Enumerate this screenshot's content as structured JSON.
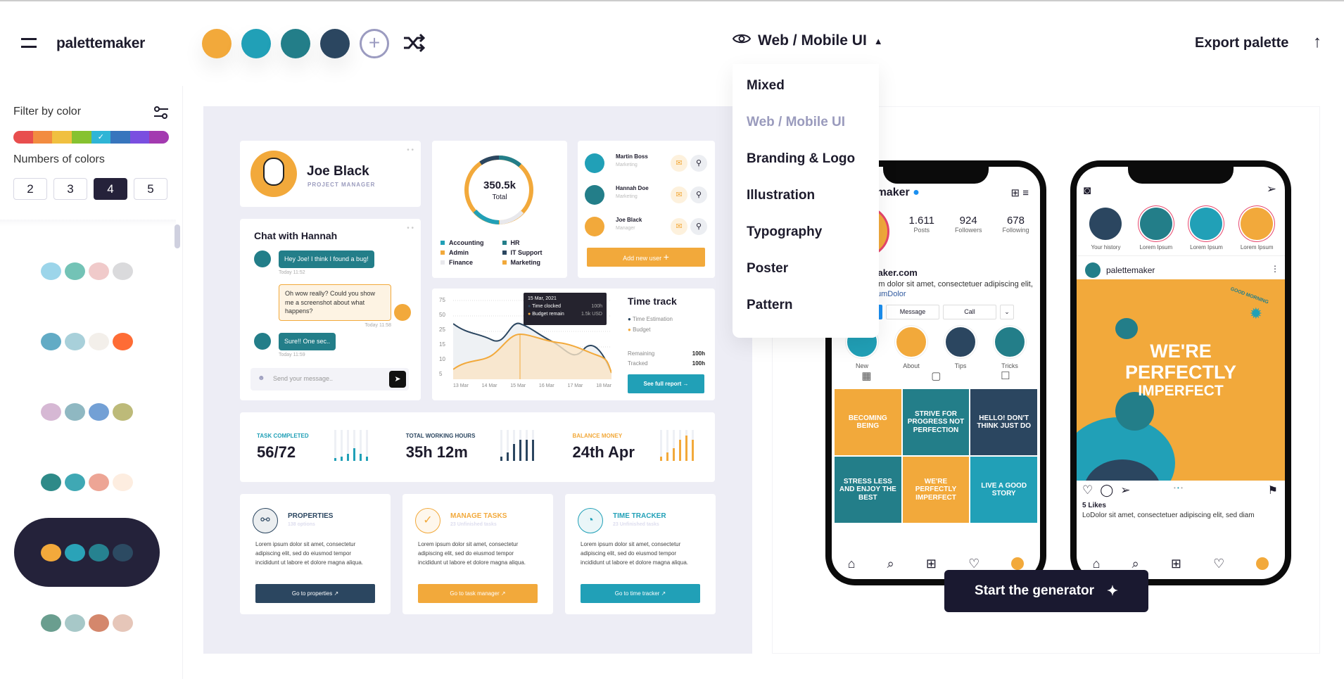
{
  "header": {
    "logo": "palettemaker",
    "palette": [
      "#F2A93B",
      "#21A0B7",
      "#237E89",
      "#2B4660"
    ],
    "add_label": "+",
    "view_label": "Web / Mobile UI",
    "export_label": "Export palette"
  },
  "dropdown": {
    "items": [
      "Mixed",
      "Web / Mobile UI",
      "Branding & Logo",
      "Illustration",
      "Typography",
      "Poster",
      "Pattern"
    ],
    "active": "Web / Mobile UI"
  },
  "sidebar": {
    "filter_label": "Filter by color",
    "color_strip": [
      "#E84E4E",
      "#F28C40",
      "#F0C040",
      "#86C230",
      "#2FB5D6",
      "#3775BD",
      "#7A4FE0",
      "#A33AB0"
    ],
    "selected_color": "#2FB5D6",
    "check": "✓",
    "numbers_label": "Numbers of colors",
    "numbers": [
      "2",
      "3",
      "4",
      "5"
    ],
    "selected_number": "4",
    "palettes": [
      [
        "#9CD5EA",
        "#73C3B6",
        "#F0CACA",
        "#DADADC"
      ],
      [
        "#62ABC5",
        "#A8D0DA",
        "#F3EFEA",
        "#FE6C35"
      ],
      [
        "#D6B8D4",
        "#8FB8C2",
        "#73A0D5",
        "#BDBA79"
      ],
      [
        "#2E8A88",
        "#3FA8B4",
        "#EDA595",
        "#FDEDE0"
      ],
      [
        "#F2A93B",
        "#2AA3B8",
        "#268290",
        "#2C4A62"
      ],
      [
        "#6A9E8F",
        "#A7C8C8",
        "#D4876C",
        "#E6C6B9"
      ]
    ],
    "selected_palette": 4
  },
  "dashboard": {
    "profile": {
      "name": "Joe Black",
      "role": "PROJECT MANAGER"
    },
    "donut": {
      "total": "350.5k",
      "label": "Total",
      "legend": [
        {
          "label": "Accounting",
          "color": "#21A0B7"
        },
        {
          "label": "HR",
          "color": "#237E89"
        },
        {
          "label": "Admin",
          "color": "#F2A93B"
        },
        {
          "label": "IT Support",
          "color": "#2B4660"
        },
        {
          "label": "Finance",
          "color": "#E8E8EC"
        },
        {
          "label": "Marketing",
          "color": "#F2A93B"
        }
      ]
    },
    "users": [
      {
        "name": "Martin Boss",
        "role": "Marketing",
        "color": "#21A0B7"
      },
      {
        "name": "Hannah Doe",
        "role": "Marketing",
        "color": "#237E89"
      },
      {
        "name": "Joe Black",
        "role": "Manager",
        "color": "#F2A93B"
      }
    ],
    "add_user": "Add new user",
    "chat": {
      "title": "Chat with Hannah",
      "messages": [
        {
          "text": "Hey Joe! I think I found a bug!",
          "time": "Today 11:52",
          "mine": false
        },
        {
          "text": "Oh wow really? Could you show me a screenshot about what happens?",
          "time": "Today 11:58",
          "mine": true
        },
        {
          "text": "Sure!! One sec..",
          "time": "Today 11:59",
          "mine": false
        }
      ],
      "placeholder": "Send your message.."
    },
    "timetrack": {
      "title": "Time track",
      "y_ticks": [
        "75",
        "50",
        "25",
        "15",
        "10",
        "5"
      ],
      "x_ticks": [
        "13 Mar",
        "14 Mar",
        "15 Mar",
        "16 Mar",
        "17 Mar",
        "18 Mar"
      ],
      "tooltip": {
        "date": "15 Mar, 2021",
        "rows": [
          {
            "label": "Time clocked",
            "value": "100h"
          },
          {
            "label": "Budget remain",
            "value": "1.5k USD"
          }
        ]
      },
      "legend": [
        "Time Estimation",
        "Budget"
      ],
      "remaining_label": "Remaining",
      "remaining": "100h",
      "tracked_label": "Tracked",
      "tracked": "100h",
      "report_btn": "See full report"
    },
    "stats": [
      {
        "label": "TASK COMPLETED",
        "value": "56/72",
        "color": "#21A0B7"
      },
      {
        "label": "TOTAL WORKING HOURS",
        "value": "35h 12m",
        "color": "#2B4660"
      },
      {
        "label": "BALANCE MONEY",
        "value": "24th Apr",
        "color": "#F2A93B"
      }
    ],
    "cards": [
      {
        "title": "PROPERTIES",
        "sub": "138 options",
        "text": "Lorem ipsum dolor sit amet, consectetur adipiscing elit, sed do eiusmod tempor incididunt ut labore et dolore magna aliqua.",
        "btn": "Go to properties",
        "color": "#2B4660"
      },
      {
        "title": "MANAGE TASKS",
        "sub": "23 Unfinished tasks",
        "text": "Lorem ipsum dolor sit amet, consectetur adipiscing elit, sed do eiusmod tempor incididunt ut labore et dolore magna aliqua.",
        "btn": "Go to task manager",
        "color": "#F2A93B"
      },
      {
        "title": "TIME TRACKER",
        "sub": "23 Unfinished tasks",
        "text": "Lorem ipsum dolor sit amet, consectetur adipiscing elit, sed do eiusmod tempor incididunt ut labore et dolore magna aliqua.",
        "btn": "Go to time tracker",
        "color": "#21A0B7"
      }
    ]
  },
  "phone1": {
    "username": "palettemaker",
    "stats": [
      {
        "n": "1.611",
        "l": "Posts"
      },
      {
        "n": "924",
        "l": "Followers"
      },
      {
        "n": "678",
        "l": "Following"
      }
    ],
    "site": "palettemaker.com",
    "bio": "Lorem ipsum dolor sit amet, consectetuer adipiscing elit,",
    "hashtag": "#LoremIpsumDolor",
    "btn_message": "Message",
    "btn_call": "Call",
    "highlights": [
      {
        "l": "New",
        "c": "#21A0B7"
      },
      {
        "l": "About",
        "c": "#F2A93B"
      },
      {
        "l": "Tips",
        "c": "#2B4660"
      },
      {
        "l": "Tricks",
        "c": "#237E89"
      }
    ],
    "tiles": [
      {
        "t": "BECOMING BEING",
        "bg": "#F2A93B"
      },
      {
        "t": "STRIVE FOR PROGRESS NOT PERFECTION",
        "bg": "#237E89"
      },
      {
        "t": "HELLO! DON'T THINK JUST DO",
        "bg": "#2B4660"
      },
      {
        "t": "STRESS LESS AND ENJOY THE BEST",
        "bg": "#237E89"
      },
      {
        "t": "WE'RE PERFECTLY IMPERFECT",
        "bg": "#F2A93B"
      },
      {
        "t": "LIVE A GOOD STORY",
        "bg": "#21A0B7"
      }
    ]
  },
  "phone2": {
    "stories": [
      {
        "l": "Your history",
        "c": "#2B4660"
      },
      {
        "l": "Lorem Ipsum",
        "c": "#237E89"
      },
      {
        "l": "Lorem Ipsum",
        "c": "#21A0B7"
      },
      {
        "l": "Lorem Ipsum",
        "c": "#F2A93B"
      }
    ],
    "username": "palettemaker",
    "post_badge": "GOOD MORNING",
    "post_text": [
      "WE'RE",
      "PERFECTLY",
      "IMPERFECT"
    ],
    "likes": "5 Likes",
    "caption": "LoDolor sit amet, consectetuer adipiscing elit, sed diam"
  },
  "generator_btn": "Start the generator"
}
